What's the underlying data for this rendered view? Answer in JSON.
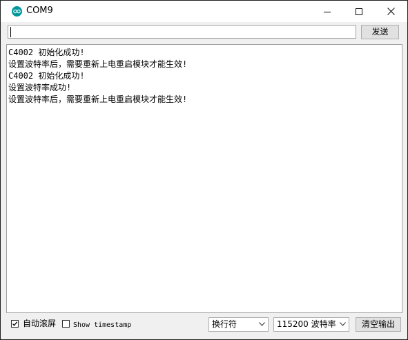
{
  "window": {
    "title": "COM9",
    "icon": "arduino-icon",
    "controls": [
      "minimize-icon",
      "maximize-icon",
      "close-icon"
    ]
  },
  "send_row": {
    "input_value": "",
    "input_placeholder": "",
    "send_label": "发送"
  },
  "console": {
    "lines": [
      "C4002 初始化成功!",
      "设置波特率后，需要重新上电重启模块才能生效!",
      "C4002 初始化成功!",
      "设置波特率成功!",
      "设置波特率后，需要重新上电重启模块才能生效!"
    ]
  },
  "bottom": {
    "autoscroll": {
      "label": "自动滚屏",
      "checked": true
    },
    "timestamp": {
      "label": "Show timestamp",
      "checked": false
    },
    "line_ending": "换行符",
    "baud_rate": "115200 波特率",
    "clear_label": "清空输出"
  },
  "colors": {
    "accent": "#00979c",
    "window_bg": "#f0f0f0",
    "button_bg": "#e1e1e1"
  }
}
